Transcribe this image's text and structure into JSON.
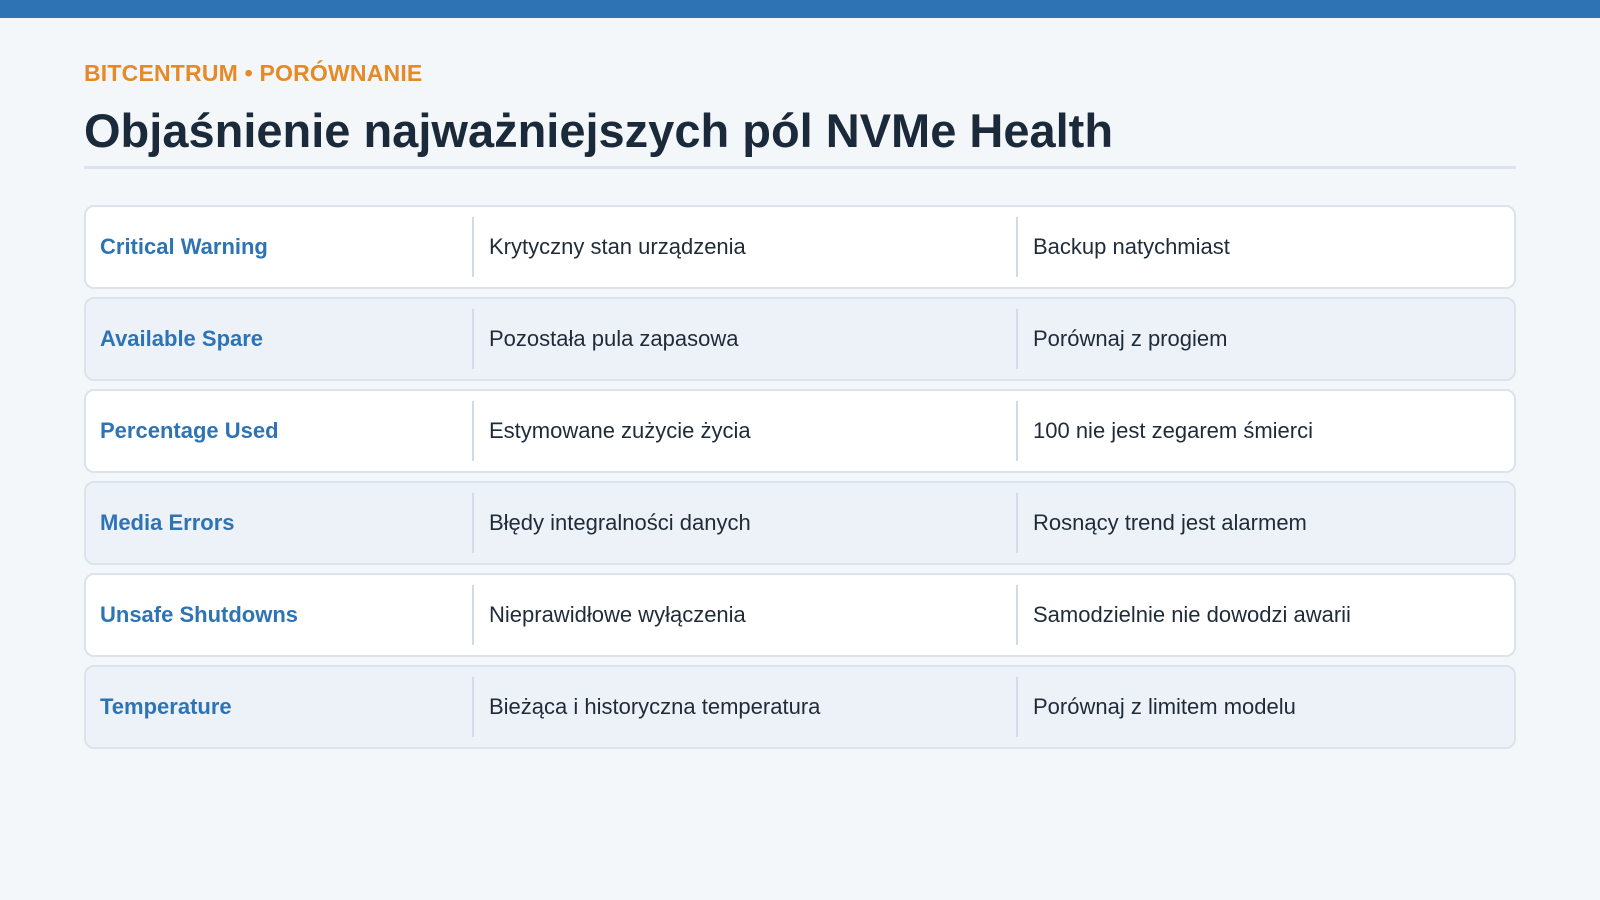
{
  "header": {
    "kicker": "BITCENTRUM • PORÓWNANIE",
    "title": "Objaśnienie najważniejszych pól NVMe Health"
  },
  "colors": {
    "accent_bar": "#2e74b5",
    "kicker": "#e58a26",
    "field_label": "#2e74b5",
    "title": "#1b2a3a"
  },
  "rows": [
    {
      "field": "Critical Warning",
      "meaning": "Krytyczny stan urządzenia",
      "action": "Backup natychmiast"
    },
    {
      "field": "Available Spare",
      "meaning": "Pozostała pula zapasowa",
      "action": "Porównaj z progiem"
    },
    {
      "field": "Percentage Used",
      "meaning": "Estymowane zużycie życia",
      "action": "100 nie jest zegarem śmierci"
    },
    {
      "field": "Media Errors",
      "meaning": "Błędy integralności danych",
      "action": "Rosnący trend jest alarmem"
    },
    {
      "field": "Unsafe Shutdowns",
      "meaning": "Nieprawidłowe wyłączenia",
      "action": "Samodzielnie nie dowodzi awarii"
    },
    {
      "field": "Temperature",
      "meaning": "Bieżąca i historyczna temperatura",
      "action": "Porównaj z limitem modelu"
    }
  ]
}
